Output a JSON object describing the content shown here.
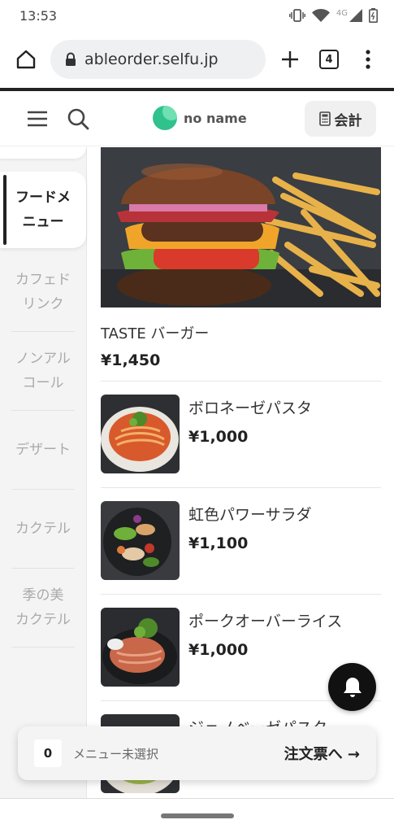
{
  "status_bar": {
    "time": "13:53",
    "network": "4G"
  },
  "browser": {
    "url": "ableorder.selfu.jp",
    "tab_count": "4"
  },
  "header": {
    "brand_name": "no name",
    "account_label": "会計"
  },
  "sidebar": {
    "categories": [
      {
        "label": "フードメ\nニュー",
        "active": true
      },
      {
        "label": "カフェド\nリンク",
        "active": false
      },
      {
        "label": "ノンアル\nコール",
        "active": false
      },
      {
        "label": "デザート",
        "active": false
      },
      {
        "label": "カクテル",
        "active": false
      },
      {
        "label": "季の美\nカクテル",
        "active": false
      }
    ]
  },
  "menu": {
    "featured": {
      "name": "TASTE バーガー",
      "price": "¥1,450"
    },
    "items": [
      {
        "name": "ボロネーゼパスタ",
        "price": "¥1,000"
      },
      {
        "name": "虹色パワーサラダ",
        "price": "¥1,100"
      },
      {
        "name": "ポークオーバーライス",
        "price": "¥1,000"
      },
      {
        "name": "ジェノベーゼパスタ",
        "price": ""
      }
    ]
  },
  "cart": {
    "count": "0",
    "status": "メニュー未選択",
    "action": "注文票へ →"
  },
  "colors": {
    "brand": "#2fc28d",
    "accent_dark": "#111111"
  }
}
